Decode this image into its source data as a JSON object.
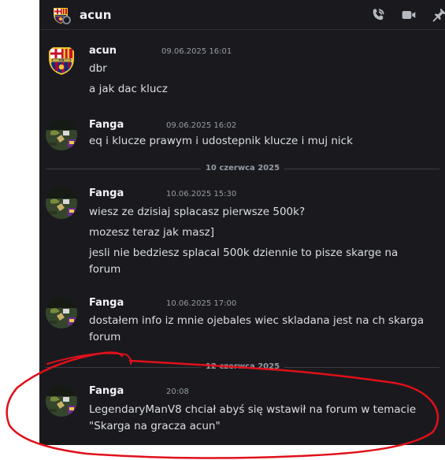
{
  "header": {
    "name": "acun",
    "icons": [
      "phone-call-icon",
      "video-icon",
      "pin-icon"
    ]
  },
  "messages": [
    {
      "author": "acun",
      "timestamp": "09.06.2025 16:01",
      "lines": [
        "dbr",
        "a jak dac klucz"
      ]
    },
    {
      "author": "Fanga",
      "timestamp": "09.06.2025 16:02",
      "lines": [
        "eq i klucze prawym i udostepnik klucze i muj nick"
      ]
    },
    {
      "author": "Fanga",
      "timestamp": "10.06.2025 15:30",
      "lines": [
        "wiesz ze dzisiaj splacasz pierwsze 500k?",
        "mozesz teraz jak masz]",
        "jesli nie bedziesz splacal 500k dziennie to pisze skarge na",
        "forum"
      ]
    },
    {
      "author": "Fanga",
      "timestamp": "10.06.2025 17:00",
      "lines": [
        "dostałem info iz mnie ojebales wiec skladana jest na ch skarga",
        "forum"
      ]
    },
    {
      "author": "Fanga",
      "timestamp": "20:08",
      "lines": [
        "LegendaryManV8 chciał abyś się wstawił na forum w temacie",
        "\"Skarga na gracza acun\""
      ]
    }
  ],
  "dividers": [
    "10 czerwca 2025",
    "12 czerwca 2025"
  ],
  "colors": {
    "background": "#1a1a1e",
    "annotation": "#e0101a",
    "text": "#dbdee1",
    "muted": "#949ba4"
  }
}
